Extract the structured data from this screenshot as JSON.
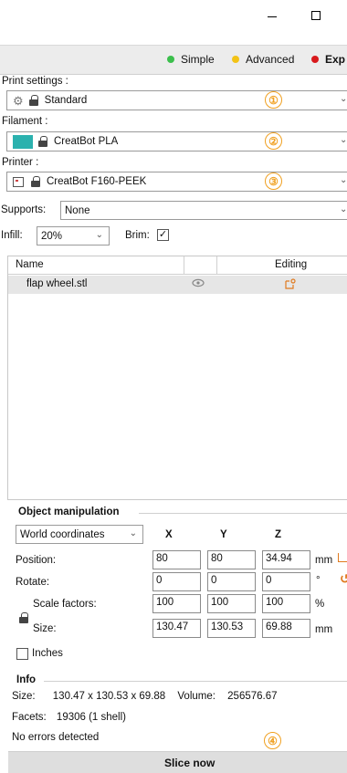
{
  "window": {
    "minimize_glyph": "—",
    "maximize_glyph": "☐"
  },
  "modes": [
    {
      "label": "Simple",
      "color": "#3bbf4c"
    },
    {
      "label": "Advanced",
      "color": "#f3c316"
    },
    {
      "label": "Exp",
      "color": "#d8191c"
    }
  ],
  "print_settings": {
    "label": "Print settings :",
    "value": "Standard",
    "icon": "gear-icon",
    "step": "①"
  },
  "filament": {
    "label": "Filament :",
    "value": "CreatBot PLA",
    "swatch_color": "#2bb1ae",
    "step": "②"
  },
  "printer": {
    "label": "Printer :",
    "value": "CreatBot F160-PEEK",
    "step": "③"
  },
  "supports": {
    "label": "Supports:",
    "value": "None"
  },
  "infill": {
    "label": "Infill:",
    "value": "20%"
  },
  "brim": {
    "label": "Brim:",
    "checked": true
  },
  "object_list": {
    "columns": [
      "Name",
      "Editing"
    ],
    "rows": [
      {
        "name": "flap wheel.stl",
        "visibility_icon": "eye-icon",
        "edit_icon": "edit-icon"
      }
    ]
  },
  "object_manipulation": {
    "title": "Object manipulation",
    "coordinates": "World coordinates",
    "axes": [
      "X",
      "Y",
      "Z"
    ],
    "position": {
      "label": "Position:",
      "x": "80",
      "y": "80",
      "z": "34.94",
      "unit": "mm"
    },
    "rotate": {
      "label": "Rotate:",
      "x": "0",
      "y": "0",
      "z": "0",
      "unit": "°"
    },
    "scale": {
      "label": "Scale factors:",
      "x": "100",
      "y": "100",
      "z": "100",
      "unit": "%"
    },
    "size": {
      "label": "Size:",
      "x": "130.47",
      "y": "130.53",
      "z": "69.88",
      "unit": "mm"
    },
    "inches": {
      "label": "Inches",
      "checked": false
    }
  },
  "info": {
    "title": "Info",
    "size_label": "Size:",
    "size_value": "130.47 x 130.53 x 69.88",
    "volume_label": "Volume:",
    "volume_value": "256576.67",
    "facets_label": "Facets:",
    "facets_value": "19306 (1 shell)",
    "errors": "No errors detected"
  },
  "slice": {
    "label": "Slice now",
    "step": "④"
  },
  "colors": {
    "accent_badge": "#f0a020",
    "selection_row": "#e6e6e6"
  }
}
